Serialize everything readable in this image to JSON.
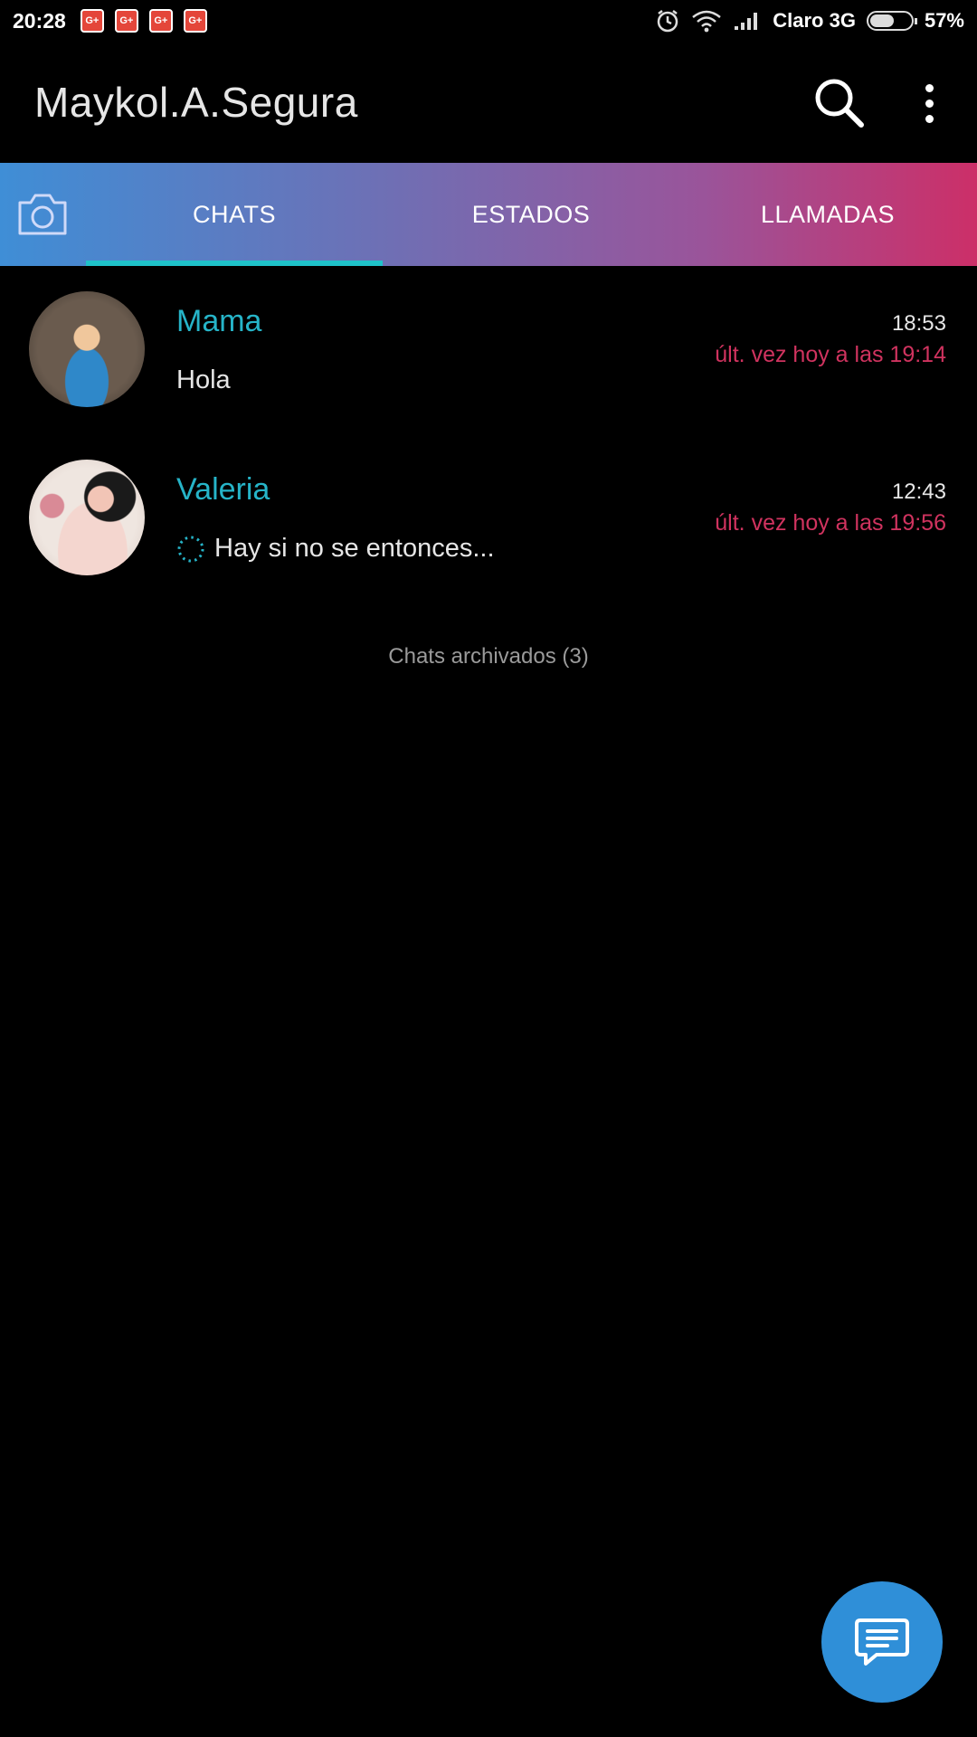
{
  "status_bar": {
    "time": "20:28",
    "notification_icons": [
      "google-plus-icon",
      "google-plus-icon",
      "google-plus-icon",
      "google-plus-icon"
    ],
    "carrier": "Claro 3G",
    "battery_percent": "57%",
    "battery_level": 0.57
  },
  "header": {
    "title": "Maykol.A.Segura",
    "icons": [
      "search-icon",
      "more-vert-icon"
    ]
  },
  "tabs": {
    "camera_icon": "camera-icon",
    "items": [
      {
        "label": "CHATS",
        "active": true
      },
      {
        "label": "ESTADOS",
        "active": false
      },
      {
        "label": "LLAMADAS",
        "active": false
      }
    ],
    "gradient_colors": [
      "#3f8ed6",
      "#6f6fb4",
      "#9a549a",
      "#cc2f68"
    ],
    "indicator_color": "#1fc2c9"
  },
  "chats": [
    {
      "name": "Mama",
      "time": "18:53",
      "last_seen": "últ. vez hoy a las 19:14",
      "preview": "Hola",
      "pending": false
    },
    {
      "name": "Valeria",
      "time": "12:43",
      "last_seen": "últ. vez hoy a las 19:56",
      "preview": "Hay si no se entonces...",
      "pending": true
    }
  ],
  "archived": {
    "label": "Chats archivados (3)"
  },
  "fab": {
    "icon": "new-chat-icon",
    "color": "#2f8fd8"
  },
  "colors": {
    "name": "#26b4c8",
    "last_seen": "#d0335f",
    "background": "#000000"
  }
}
